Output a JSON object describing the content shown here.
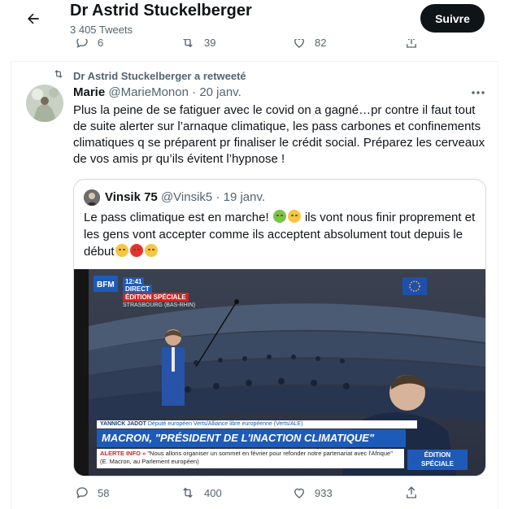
{
  "header": {
    "title": "Dr Astrid Stuckelberger",
    "subtitle": "3 405 Tweets",
    "follow_label": "Suivre"
  },
  "top_actions": {
    "replies": "6",
    "retweets": "39",
    "likes": "82"
  },
  "retweet_context": "Dr Astrid Stuckelberger a retweeté",
  "tweet": {
    "name": "Marie",
    "handle": "@MarieMonon",
    "separator": "·",
    "date": "20 janv.",
    "text": "Plus la peine de se fatiguer avec le covid on a gagné…pr contre il faut tout de suite alerter sur l’arnaque climatique, les pass carbones et confinements climatiques q se préparent pr finaliser le crédit social. Préparez les cerveaux de vos amis pr qu’ils évitent l’hypnose !"
  },
  "quoted": {
    "name": "Vinsik 75",
    "handle": "@Vinsik5",
    "separator": "·",
    "date": "19 janv.",
    "text_part1": "Le pass climatique est en marche!",
    "text_part2": "ils vont nous finir proprement et les gens vont accepter comme ils acceptent absolument tout depuis le début",
    "emojis": [
      "nauseated-face",
      "expressionless-face",
      "relieved-face",
      "angry-face",
      "expressionless-face"
    ]
  },
  "tv_overlay": {
    "channel": "BFM",
    "time": "12:41",
    "live": "DIRECT",
    "edition": "ÉDITION SPÉCIALE",
    "place": "STRASBOURG (BAS-RHIN)",
    "speaker": "YANNICK JADOT",
    "speaker_role": "Député européen Verts/Alliance libre européenne (Verts/ALE)",
    "headline": "MACRON, \"PRÉSIDENT DE L'INACTION CLIMATIQUE\"",
    "alert_label": "ALERTE INFO »",
    "alert_text": "\"Nous allons organiser un sommet en février pour refonder notre partenariat avec l'Afrique\" (E. Macron, au Parlement européen)",
    "special_line1": "ÉDITION",
    "special_line2": "SPÉCIALE"
  },
  "bottom_actions": {
    "replies": "58",
    "retweets": "400",
    "likes": "933"
  },
  "colors": {
    "text": "#0f1419",
    "secondary": "#536471",
    "follow_bg": "#0f1419",
    "border": "#cfd9de",
    "tv_blue": "#1e5bb8",
    "tv_red": "#d4231e"
  }
}
